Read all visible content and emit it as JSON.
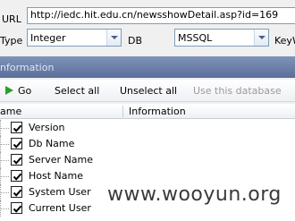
{
  "form": {
    "url_label": "URL",
    "url_value": "http://iedc.hit.edu.cn/newsshowDetail.asp?id=169",
    "type_label": "Type",
    "type_value": "Integer",
    "db_label": "DB",
    "db_value": "MSSQL",
    "keyword_label": "KeyW"
  },
  "section": {
    "title": "nformation"
  },
  "toolbar": {
    "go_label": "Go",
    "select_all_label": "Select all",
    "unselect_all_label": "Unselect all",
    "use_db_label": "Use this database"
  },
  "grid": {
    "columns": [
      "ame",
      "Information"
    ],
    "rows": [
      {
        "label": "Version",
        "checked": true
      },
      {
        "label": "Db Name",
        "checked": true
      },
      {
        "label": "Server Name",
        "checked": true
      },
      {
        "label": "Host Name",
        "checked": true
      },
      {
        "label": "System User",
        "checked": true
      },
      {
        "label": "Current User",
        "checked": true
      }
    ]
  },
  "watermark": "www.wooyun.org",
  "colors": {
    "section_header": "#6b7fa8",
    "go_icon": "#2e9e2e",
    "disabled_text": "#9a9a9a"
  }
}
